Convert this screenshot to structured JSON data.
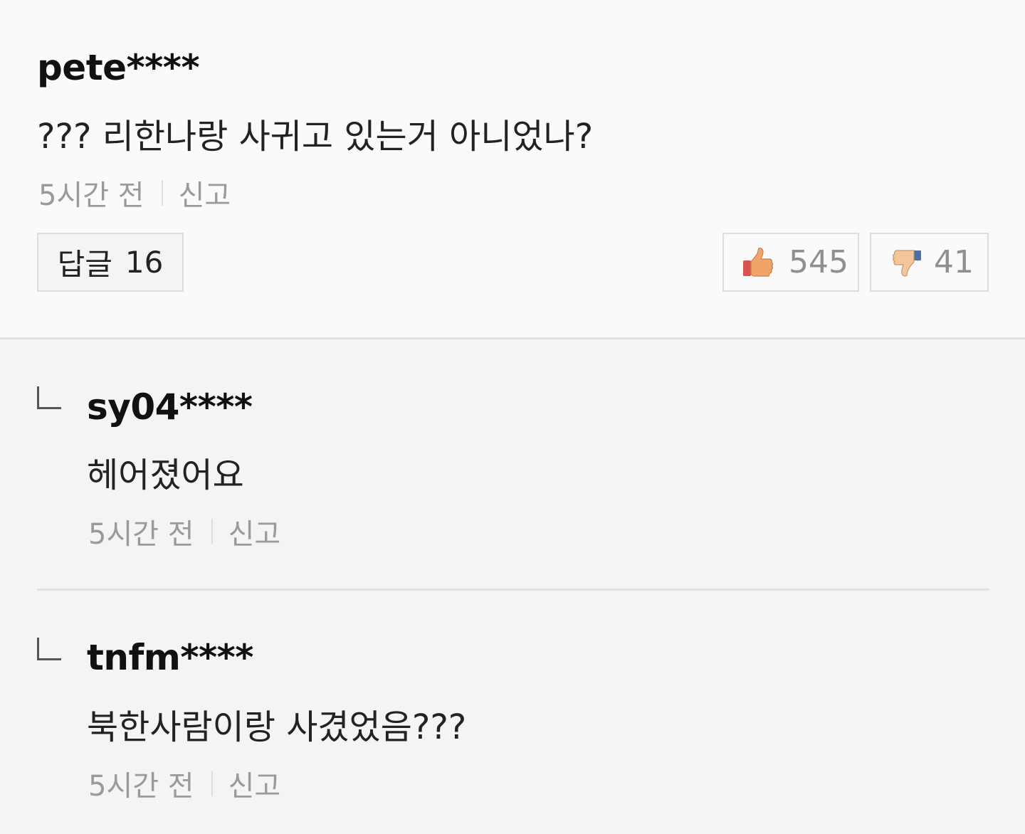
{
  "comment": {
    "username": "pete****",
    "text": "??? 리한나랑 사귀고 있는거 아니었나?",
    "time": "5시간 전",
    "report_label": "신고",
    "reply_label": "답글",
    "reply_count": "16",
    "likes": "545",
    "dislikes": "41"
  },
  "replies": [
    {
      "username": "sy04****",
      "text": "헤어졌어요",
      "time": "5시간 전",
      "report_label": "신고"
    },
    {
      "username": "tnfm****",
      "text": "북한사람이랑 사겼었음???",
      "time": "5시간 전",
      "report_label": "신고"
    }
  ],
  "colors": {
    "like_icon": "#f0a469",
    "like_cuff": "#d9534f",
    "dislike_icon": "#f3c79a",
    "dislike_cuff": "#4a6fa5"
  }
}
